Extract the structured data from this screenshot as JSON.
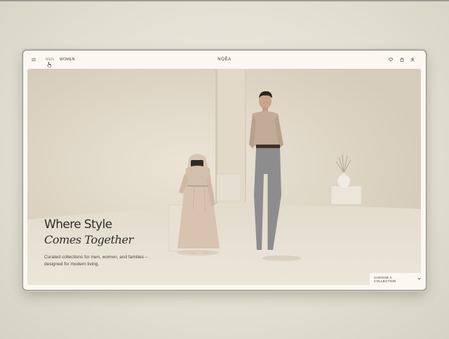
{
  "nav": {
    "menu_icon": "menu-icon",
    "links": [
      {
        "label": "MEN",
        "state": "hover"
      },
      {
        "label": "WOMEN",
        "state": "default"
      }
    ],
    "brand": "NOÉA",
    "icons": [
      "heart-icon",
      "shopping-bag-icon",
      "user-icon"
    ]
  },
  "hero": {
    "headline_line1": "Where Style",
    "headline_line2": "Comes Together",
    "description": "Curated collections for men, women, and families – designed for modern living.",
    "cta_label": "CHOOSE A COLLECTION",
    "cta_icon": "chevron-down-icon"
  },
  "colors": {
    "background": "#e3e1d4",
    "window": "#faf8f0",
    "text": "#2f2c27",
    "hero_tone": "#ddd3c3"
  }
}
